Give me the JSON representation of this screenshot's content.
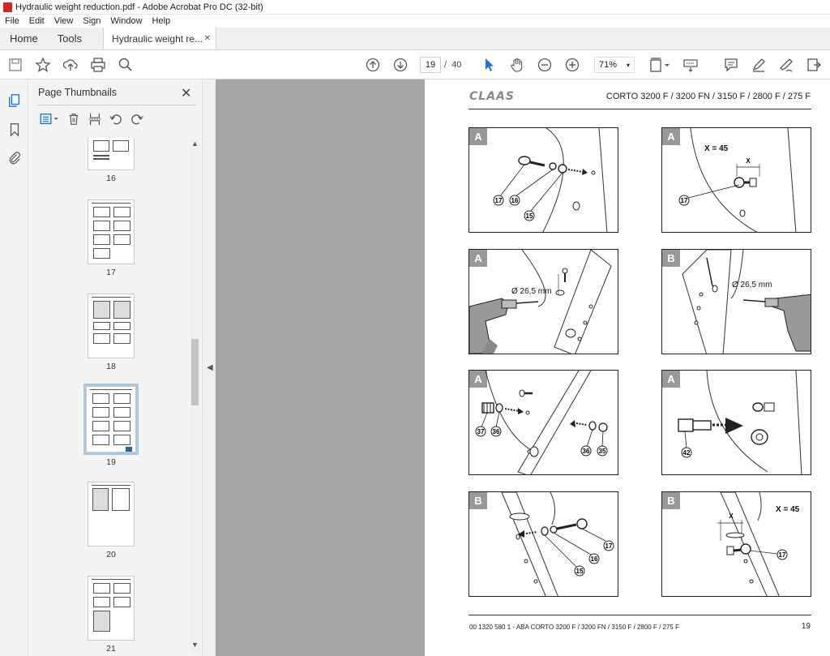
{
  "window": {
    "title": "Hydraulic weight reduction.pdf - Adobe Acrobat Pro DC (32-bit)"
  },
  "menu": [
    "File",
    "Edit",
    "View",
    "Sign",
    "Window",
    "Help"
  ],
  "tabs": {
    "home": "Home",
    "tools": "Tools",
    "document": "Hydraulic weight re...",
    "close": "✕"
  },
  "toolbar": {
    "current_page": "19",
    "page_separator": "/",
    "total_pages": "40",
    "zoom": "71%"
  },
  "sidebar": {
    "title": "Page Thumbnails",
    "close": "✕"
  },
  "thumbnails": [
    {
      "label": "16",
      "selected": false
    },
    {
      "label": "17",
      "selected": false
    },
    {
      "label": "18",
      "selected": false
    },
    {
      "label": "19",
      "selected": true
    },
    {
      "label": "20",
      "selected": false
    },
    {
      "label": "21",
      "selected": false
    }
  ],
  "page": {
    "brand": "CLAAS",
    "model_header": "CORTO 3200 F / 3200 FN / 3150 F / 2800 F / 275 F",
    "footer_left": "00 1320 580 1 - ABA CORTO 3200 F / 3200 FN / 3150 F / 2800 F / 275 F",
    "page_number": "19",
    "panels": [
      {
        "label": "A",
        "callouts": [
          "17",
          "16",
          "15"
        ],
        "dimension": ""
      },
      {
        "label": "A",
        "callouts": [
          "17"
        ],
        "dimension": "X = 45",
        "dim_mark": "X"
      },
      {
        "label": "A",
        "callouts": [],
        "dimension": "Ø 26,5 mm"
      },
      {
        "label": "B",
        "callouts": [],
        "dimension": "Ø 26,5 mm"
      },
      {
        "label": "A",
        "callouts": [
          "37",
          "36",
          "36",
          "35"
        ],
        "dimension": ""
      },
      {
        "label": "A",
        "callouts": [
          "42"
        ],
        "dimension": ""
      },
      {
        "label": "B",
        "callouts": [
          "17",
          "16",
          "15"
        ],
        "dimension": ""
      },
      {
        "label": "B",
        "callouts": [
          "17"
        ],
        "dimension": "X = 45",
        "dim_mark": "X"
      }
    ]
  },
  "colors": {
    "accent": "#1473e6",
    "viewer_bg": "#a6a6a6",
    "panel_label_bg": "#999999",
    "selected_thumb": "#a6c8e8"
  }
}
